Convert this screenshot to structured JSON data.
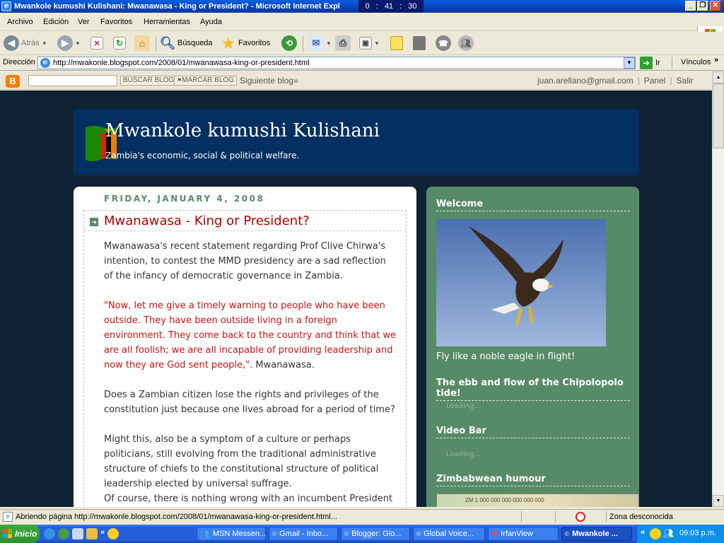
{
  "window": {
    "title": "Mwankole kumushi Kulishani: Mwanawasa - King or President? - Microsoft Internet Expl",
    "clock": "0 : 41 : 30"
  },
  "menu": {
    "items": [
      "Archivo",
      "Edición",
      "Ver",
      "Favoritos",
      "Herramientas",
      "Ayuda"
    ]
  },
  "toolbar": {
    "back": "Atrás",
    "search": "Búsqueda",
    "favorites": "Favoritos"
  },
  "address": {
    "label": "Dirección",
    "url": "http://mwakonle.blogspot.com/2008/01/mwanawasa-king-or-president.html",
    "go": "Ir",
    "links": "Vínculos"
  },
  "blogger_nav": {
    "search_button": "BUSCAR BLOG",
    "flag_button": "MARCAR BLOG",
    "next_blog": "Siguiente blog»",
    "email": "juan.arellano@gmail.com",
    "panel": "Panel",
    "logout": "Salir"
  },
  "blog": {
    "title": "Mwankole kumushi Kulishani",
    "description": "Zambia's economic, social & political welfare."
  },
  "post": {
    "date": "FRIDAY, JANUARY 4, 2008",
    "title": "Mwanawasa - King or President?",
    "p1": "Mwanawasa's recent statement regarding Prof Clive Chirwa's intention, to contest the MMD presidency are a sad reflection of the infancy of democratic governance in Zambia.",
    "quote": "\"Now, let me give a timely warning to people who have been outside. They have been outside living in a foreign environment. They come back to the country and think that we are all foolish; we are all incapable of providing leadership and now they are God sent people,\".",
    "quote_attrib": " Mwanawasa.",
    "p2": "Does a Zambian citizen lose the rights and privileges of the constitution just because one lives abroad for a period of time?",
    "p3": "Might this, also be a symptom of a culture or perhaps politicians, still evolving from the traditional administrative structure of chiefs to the constitutional structure of political leadership elected by universal suffrage.",
    "p4": "Of course, there is nothing wrong with an incumbent President"
  },
  "sidebar": {
    "welcome_title": "Welcome",
    "caption": "Fly like a noble eagle in flight!",
    "widget1_title": "The ebb and flow of the Chipolopolo tide!",
    "widget1_loading": "Loading...",
    "widget2_title": "Video Bar",
    "widget2_loading": "Loading...",
    "widget3_title": "Zimbabwean humour",
    "banknote_text": "ZM 1 000 000 000 000 000 000"
  },
  "status": {
    "text": "Abriendo página http://mwakonle.blogspot.com/2008/01/mwanawasa-king-or-president.html...",
    "zone": "Zona desconocida"
  },
  "taskbar": {
    "start": "Inicio",
    "tasks": [
      "MSN Messen...",
      "Gmail - Inbo...",
      "Blogger: Glo...",
      "Global Voice...",
      "IrfanView",
      "Mwankole ..."
    ],
    "time": "09:03 p.m."
  },
  "colors": {
    "page_bg": "#0f2233",
    "header_bg": "#033060",
    "sidebar_bg": "#578a67",
    "post_title": "#b30000",
    "quote": "#cc1111",
    "date": "#5a8a6a"
  }
}
